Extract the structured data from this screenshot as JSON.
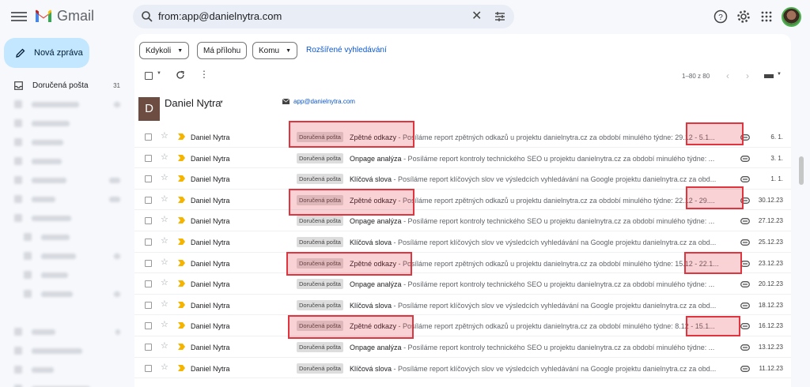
{
  "app": {
    "name": "Gmail"
  },
  "search": {
    "query": "from:app@danielnytra.com"
  },
  "compose": {
    "label": "Nová zpráva"
  },
  "nav": {
    "inbox": {
      "label": "Doručená pošta",
      "count": "31"
    }
  },
  "filters": {
    "chips": [
      "Kdykoli",
      "Má přílohu",
      "Komu"
    ],
    "advanced": "Rozšířené vyhledávání"
  },
  "pagination": {
    "range": "1–80 z 80"
  },
  "sender": {
    "initial": "D",
    "name": "Daniel Nytra",
    "email": "app@danielnytra.com"
  },
  "accent": "#0b57d0",
  "highlight_color": "#e0343f",
  "emails": [
    {
      "sender": "Daniel Nytra",
      "label": "Doručená pošta",
      "subject": "Zpětné odkazy",
      "snippet": " - Posíláme report zpětných odkazů u projektu danielnytra.cz za období minulého týdne: 29.12 - 5.1...",
      "date": "6. 1."
    },
    {
      "sender": "Daniel Nytra",
      "label": "Doručená pošta",
      "subject": "Onpage analýza",
      "snippet": " - Posíláme report kontroly technického SEO u projektu danielnytra.cz za období minulého týdne: ...",
      "date": "3. 1."
    },
    {
      "sender": "Daniel Nytra",
      "label": "Doručená pošta",
      "subject": "Klíčová slova",
      "snippet": " - Posíláme report klíčových slov ve výsledcích vyhledávání na Google projektu danielnytra.cz za obd...",
      "date": "1. 1."
    },
    {
      "sender": "Daniel Nytra",
      "label": "Doručená pošta",
      "subject": "Zpětné odkazy",
      "snippet": " - Posíláme report zpětných odkazů u projektu danielnytra.cz za období minulého týdne: 22.12 - 29....",
      "date": "30.12.23"
    },
    {
      "sender": "Daniel Nytra",
      "label": "Doručená pošta",
      "subject": "Onpage analýza",
      "snippet": " - Posíláme report kontroly technického SEO u projektu danielnytra.cz za období minulého týdne: ...",
      "date": "27.12.23"
    },
    {
      "sender": "Daniel Nytra",
      "label": "Doručená pošta",
      "subject": "Klíčová slova",
      "snippet": " - Posíláme report klíčových slov ve výsledcích vyhledávání na Google projektu danielnytra.cz za obd...",
      "date": "25.12.23"
    },
    {
      "sender": "Daniel Nytra",
      "label": "Doručená pošta",
      "subject": "Zpětné odkazy",
      "snippet": " - Posíláme report zpětných odkazů u projektu danielnytra.cz za období minulého týdne: 15.12 - 22.1...",
      "date": "23.12.23"
    },
    {
      "sender": "Daniel Nytra",
      "label": "Doručená pošta",
      "subject": "Onpage analýza",
      "snippet": " - Posíláme report kontroly technického SEO u projektu danielnytra.cz za období minulého týdne: ...",
      "date": "20.12.23"
    },
    {
      "sender": "Daniel Nytra",
      "label": "Doručená pošta",
      "subject": "Klíčová slova",
      "snippet": " - Posíláme report klíčových slov ve výsledcích vyhledávání na Google projektu danielnytra.cz za obd...",
      "date": "18.12.23"
    },
    {
      "sender": "Daniel Nytra",
      "label": "Doručená pošta",
      "subject": "Zpětné odkazy",
      "snippet": " - Posíláme report zpětných odkazů u projektu danielnytra.cz za období minulého týdne: 8.12 - 15.1...",
      "date": "16.12.23"
    },
    {
      "sender": "Daniel Nytra",
      "label": "Doručená pošta",
      "subject": "Onpage analýza",
      "snippet": " - Posíláme report kontroly technického SEO u projektu danielnytra.cz za období minulého týdne: ...",
      "date": "13.12.23"
    },
    {
      "sender": "Daniel Nytra",
      "label": "Doručená pošta",
      "subject": "Klíčová slova",
      "snippet": " - Posíláme report klíčových slov ve výsledcích vyhledávání na Google projektu danielnytra.cz za obd...",
      "date": "11.12.23"
    }
  ]
}
